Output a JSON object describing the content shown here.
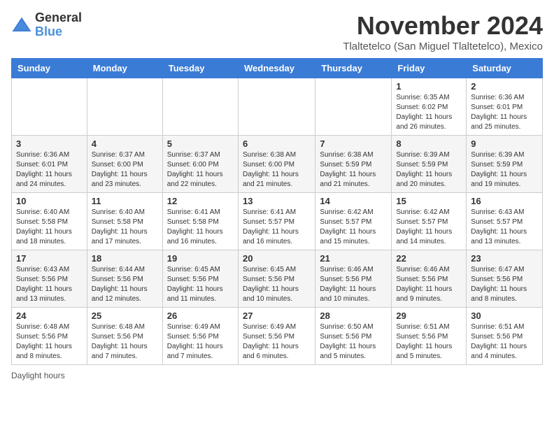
{
  "header": {
    "logo_general": "General",
    "logo_blue": "Blue",
    "month_title": "November 2024",
    "subtitle": "Tlaltetelco (San Miguel Tlaltetelco), Mexico"
  },
  "days_of_week": [
    "Sunday",
    "Monday",
    "Tuesday",
    "Wednesday",
    "Thursday",
    "Friday",
    "Saturday"
  ],
  "weeks": [
    [
      {
        "day": "",
        "info": ""
      },
      {
        "day": "",
        "info": ""
      },
      {
        "day": "",
        "info": ""
      },
      {
        "day": "",
        "info": ""
      },
      {
        "day": "",
        "info": ""
      },
      {
        "day": "1",
        "info": "Sunrise: 6:35 AM\nSunset: 6:02 PM\nDaylight: 11 hours and 26 minutes."
      },
      {
        "day": "2",
        "info": "Sunrise: 6:36 AM\nSunset: 6:01 PM\nDaylight: 11 hours and 25 minutes."
      }
    ],
    [
      {
        "day": "3",
        "info": "Sunrise: 6:36 AM\nSunset: 6:01 PM\nDaylight: 11 hours and 24 minutes."
      },
      {
        "day": "4",
        "info": "Sunrise: 6:37 AM\nSunset: 6:00 PM\nDaylight: 11 hours and 23 minutes."
      },
      {
        "day": "5",
        "info": "Sunrise: 6:37 AM\nSunset: 6:00 PM\nDaylight: 11 hours and 22 minutes."
      },
      {
        "day": "6",
        "info": "Sunrise: 6:38 AM\nSunset: 6:00 PM\nDaylight: 11 hours and 21 minutes."
      },
      {
        "day": "7",
        "info": "Sunrise: 6:38 AM\nSunset: 5:59 PM\nDaylight: 11 hours and 21 minutes."
      },
      {
        "day": "8",
        "info": "Sunrise: 6:39 AM\nSunset: 5:59 PM\nDaylight: 11 hours and 20 minutes."
      },
      {
        "day": "9",
        "info": "Sunrise: 6:39 AM\nSunset: 5:59 PM\nDaylight: 11 hours and 19 minutes."
      }
    ],
    [
      {
        "day": "10",
        "info": "Sunrise: 6:40 AM\nSunset: 5:58 PM\nDaylight: 11 hours and 18 minutes."
      },
      {
        "day": "11",
        "info": "Sunrise: 6:40 AM\nSunset: 5:58 PM\nDaylight: 11 hours and 17 minutes."
      },
      {
        "day": "12",
        "info": "Sunrise: 6:41 AM\nSunset: 5:58 PM\nDaylight: 11 hours and 16 minutes."
      },
      {
        "day": "13",
        "info": "Sunrise: 6:41 AM\nSunset: 5:57 PM\nDaylight: 11 hours and 16 minutes."
      },
      {
        "day": "14",
        "info": "Sunrise: 6:42 AM\nSunset: 5:57 PM\nDaylight: 11 hours and 15 minutes."
      },
      {
        "day": "15",
        "info": "Sunrise: 6:42 AM\nSunset: 5:57 PM\nDaylight: 11 hours and 14 minutes."
      },
      {
        "day": "16",
        "info": "Sunrise: 6:43 AM\nSunset: 5:57 PM\nDaylight: 11 hours and 13 minutes."
      }
    ],
    [
      {
        "day": "17",
        "info": "Sunrise: 6:43 AM\nSunset: 5:56 PM\nDaylight: 11 hours and 13 minutes."
      },
      {
        "day": "18",
        "info": "Sunrise: 6:44 AM\nSunset: 5:56 PM\nDaylight: 11 hours and 12 minutes."
      },
      {
        "day": "19",
        "info": "Sunrise: 6:45 AM\nSunset: 5:56 PM\nDaylight: 11 hours and 11 minutes."
      },
      {
        "day": "20",
        "info": "Sunrise: 6:45 AM\nSunset: 5:56 PM\nDaylight: 11 hours and 10 minutes."
      },
      {
        "day": "21",
        "info": "Sunrise: 6:46 AM\nSunset: 5:56 PM\nDaylight: 11 hours and 10 minutes."
      },
      {
        "day": "22",
        "info": "Sunrise: 6:46 AM\nSunset: 5:56 PM\nDaylight: 11 hours and 9 minutes."
      },
      {
        "day": "23",
        "info": "Sunrise: 6:47 AM\nSunset: 5:56 PM\nDaylight: 11 hours and 8 minutes."
      }
    ],
    [
      {
        "day": "24",
        "info": "Sunrise: 6:48 AM\nSunset: 5:56 PM\nDaylight: 11 hours and 8 minutes."
      },
      {
        "day": "25",
        "info": "Sunrise: 6:48 AM\nSunset: 5:56 PM\nDaylight: 11 hours and 7 minutes."
      },
      {
        "day": "26",
        "info": "Sunrise: 6:49 AM\nSunset: 5:56 PM\nDaylight: 11 hours and 7 minutes."
      },
      {
        "day": "27",
        "info": "Sunrise: 6:49 AM\nSunset: 5:56 PM\nDaylight: 11 hours and 6 minutes."
      },
      {
        "day": "28",
        "info": "Sunrise: 6:50 AM\nSunset: 5:56 PM\nDaylight: 11 hours and 5 minutes."
      },
      {
        "day": "29",
        "info": "Sunrise: 6:51 AM\nSunset: 5:56 PM\nDaylight: 11 hours and 5 minutes."
      },
      {
        "day": "30",
        "info": "Sunrise: 6:51 AM\nSunset: 5:56 PM\nDaylight: 11 hours and 4 minutes."
      }
    ]
  ],
  "legend": "Daylight hours"
}
